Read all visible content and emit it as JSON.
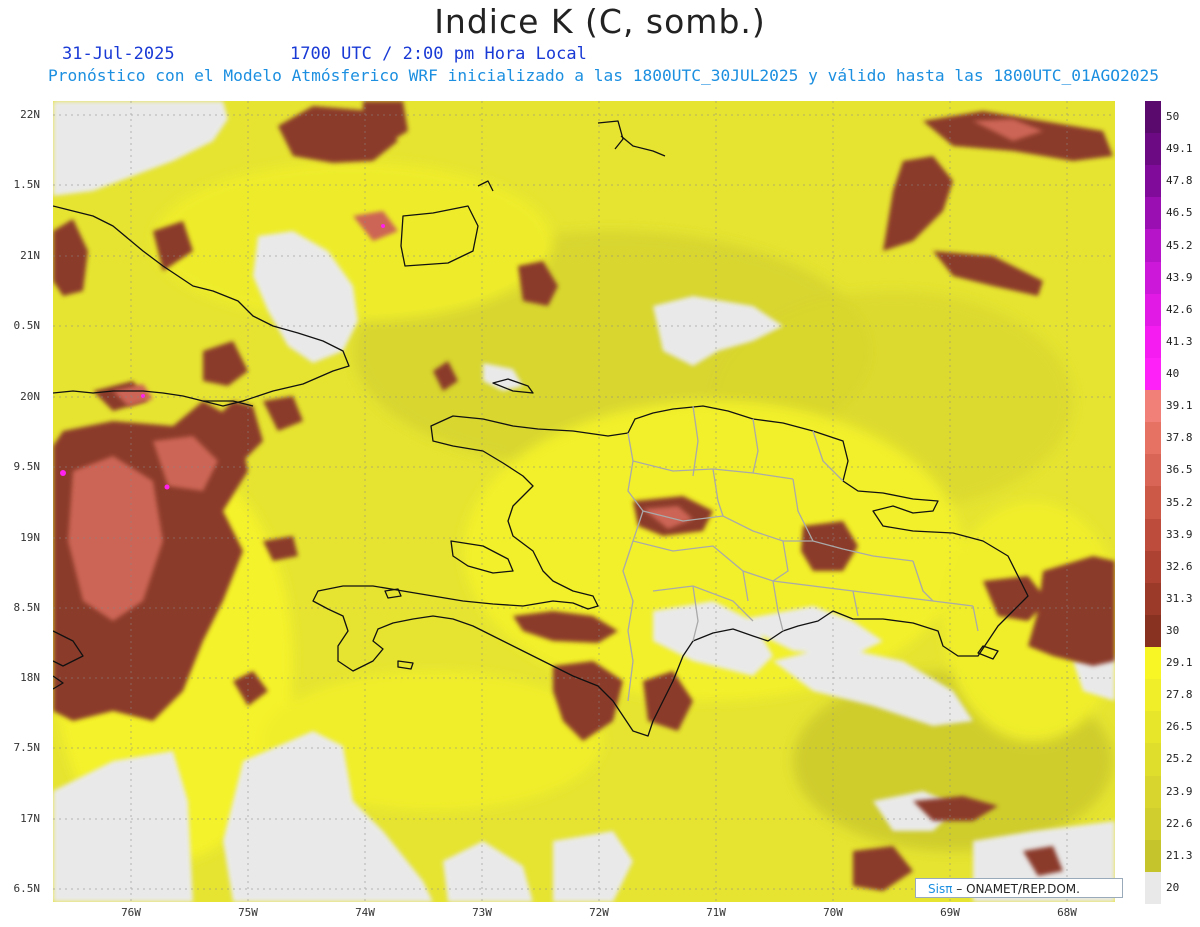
{
  "header": {
    "title": "Indice K (C, somb.)",
    "date": "31-Jul-2025",
    "time": "1700 UTC / 2:00 pm Hora Local",
    "description": "Pronóstico con el Modelo Atmósferico WRF inicializado a las 1800UTC_30JUL2025 y válido hasta las  1800UTC_01AGO2025"
  },
  "map": {
    "lat_range": [
      16.35,
      22.1
    ],
    "lon_range": [
      -76.6,
      -67.55
    ],
    "lat_ticks": [
      "22N",
      "1.5N",
      "21N",
      "0.5N",
      "20N",
      "9.5N",
      "19N",
      "8.5N",
      "18N",
      "7.5N",
      "17N",
      "6.5N"
    ],
    "lon_ticks": [
      "76W",
      "75W",
      "74W",
      "73W",
      "72W",
      "71W",
      "70W",
      "69W",
      "68W"
    ],
    "colors": {
      "background": "#e9e9e9",
      "yellow_bright": "#f4f22a",
      "yellow_mid": "#e2e031",
      "yellow_dark": "#c8c62e",
      "brown": "#8b3a2a",
      "salmon": "#cc6555",
      "magenta": "#ff22ee",
      "coast": "#111111",
      "province_border": "#aaaaaa"
    }
  },
  "colorbar": {
    "labels": [
      "50",
      "49.1",
      "47.8",
      "46.5",
      "45.2",
      "43.9",
      "42.6",
      "41.3",
      "40",
      "39.1",
      "37.8",
      "36.5",
      "35.2",
      "33.9",
      "32.6",
      "31.3",
      "30",
      "29.1",
      "27.8",
      "26.5",
      "25.2",
      "23.9",
      "22.6",
      "21.3",
      "20"
    ],
    "colors": [
      "#5a0a6c",
      "#6b0a82",
      "#800a99",
      "#9a0fb2",
      "#b614c8",
      "#cc18d8",
      "#e21ae6",
      "#f41cf0",
      "#ff22f8",
      "#f08078",
      "#e57262",
      "#d96556",
      "#cc5848",
      "#bd4c3c",
      "#ae4232",
      "#9c3a2a",
      "#883222",
      "#f8f624",
      "#f0ee28",
      "#e8e62a",
      "#e0de2d",
      "#d8d62e",
      "#d0ce2e",
      "#c6c42c",
      "#e9e9e9"
    ]
  },
  "credit": {
    "brand": "Sisπ",
    "org": " – ONAMET/REP.DOM."
  }
}
